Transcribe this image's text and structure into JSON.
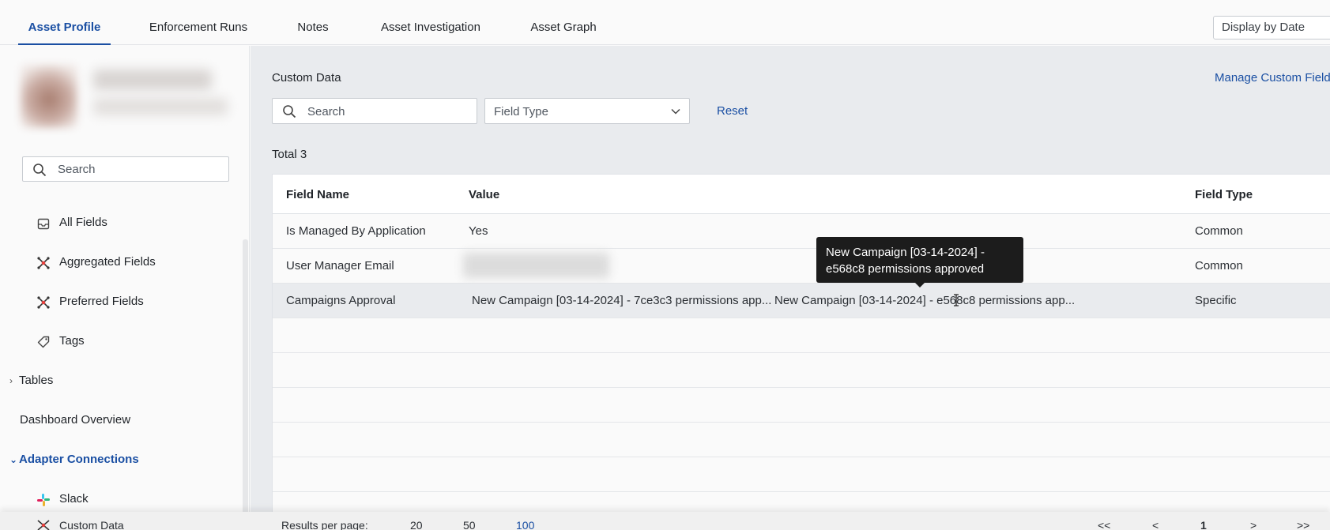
{
  "tabs": [
    {
      "label": "Asset Profile",
      "active": true
    },
    {
      "label": "Enforcement Runs"
    },
    {
      "label": "Notes"
    },
    {
      "label": "Asset Investigation"
    },
    {
      "label": "Asset Graph"
    }
  ],
  "display_select": "Display by Date",
  "sidebar": {
    "search_placeholder": "Search",
    "items": [
      {
        "label": "All Fields",
        "icon": "inbox-icon"
      },
      {
        "label": "Aggregated Fields",
        "icon": "aggregate-icon"
      },
      {
        "label": "Preferred Fields",
        "icon": "aggregate-icon"
      },
      {
        "label": "Tags",
        "icon": "tag-icon"
      }
    ],
    "tables_label": "Tables",
    "dashboard_label": "Dashboard Overview",
    "adapter_connections_label": "Adapter Connections",
    "adapters": [
      {
        "label": "Slack",
        "icon": "slack-icon"
      },
      {
        "label": "Custom Data",
        "icon": "custom-data-icon"
      }
    ]
  },
  "main": {
    "title": "Custom Data",
    "manage_link": "Manage Custom Fields",
    "search_placeholder": "Search",
    "field_type_placeholder": "Field Type",
    "reset_label": "Reset",
    "total_label": "Total 3",
    "columns": [
      "Field Name",
      "Value",
      "Field Type"
    ],
    "rows": [
      {
        "name": "Is Managed By Application",
        "value": "Yes",
        "type": "Common"
      },
      {
        "name": "User Manager Email",
        "value": "",
        "type": "Common"
      },
      {
        "name": "Campaigns Approval",
        "value": "New Campaign [03-14-2024] - 7ce3c3 permissions app...",
        "value2": "New Campaign [03-14-2024] - e568c8 permissions app...",
        "type": "Specific"
      }
    ],
    "tooltip": "New Campaign [03-14-2024] - e568c8 permissions approved"
  },
  "footer": {
    "results_per_page_label": "Results per page:",
    "page_sizes": [
      "20",
      "50",
      "100"
    ],
    "selected_page_size": "100",
    "first_label": "<<",
    "prev_label": "<",
    "current_page": "1",
    "next_label": ">",
    "last_label": ">>"
  },
  "colors": {
    "accent": "#1a4fa3",
    "tooltip_bg": "#1c1c1c",
    "main_bg": "#e9ebee"
  }
}
